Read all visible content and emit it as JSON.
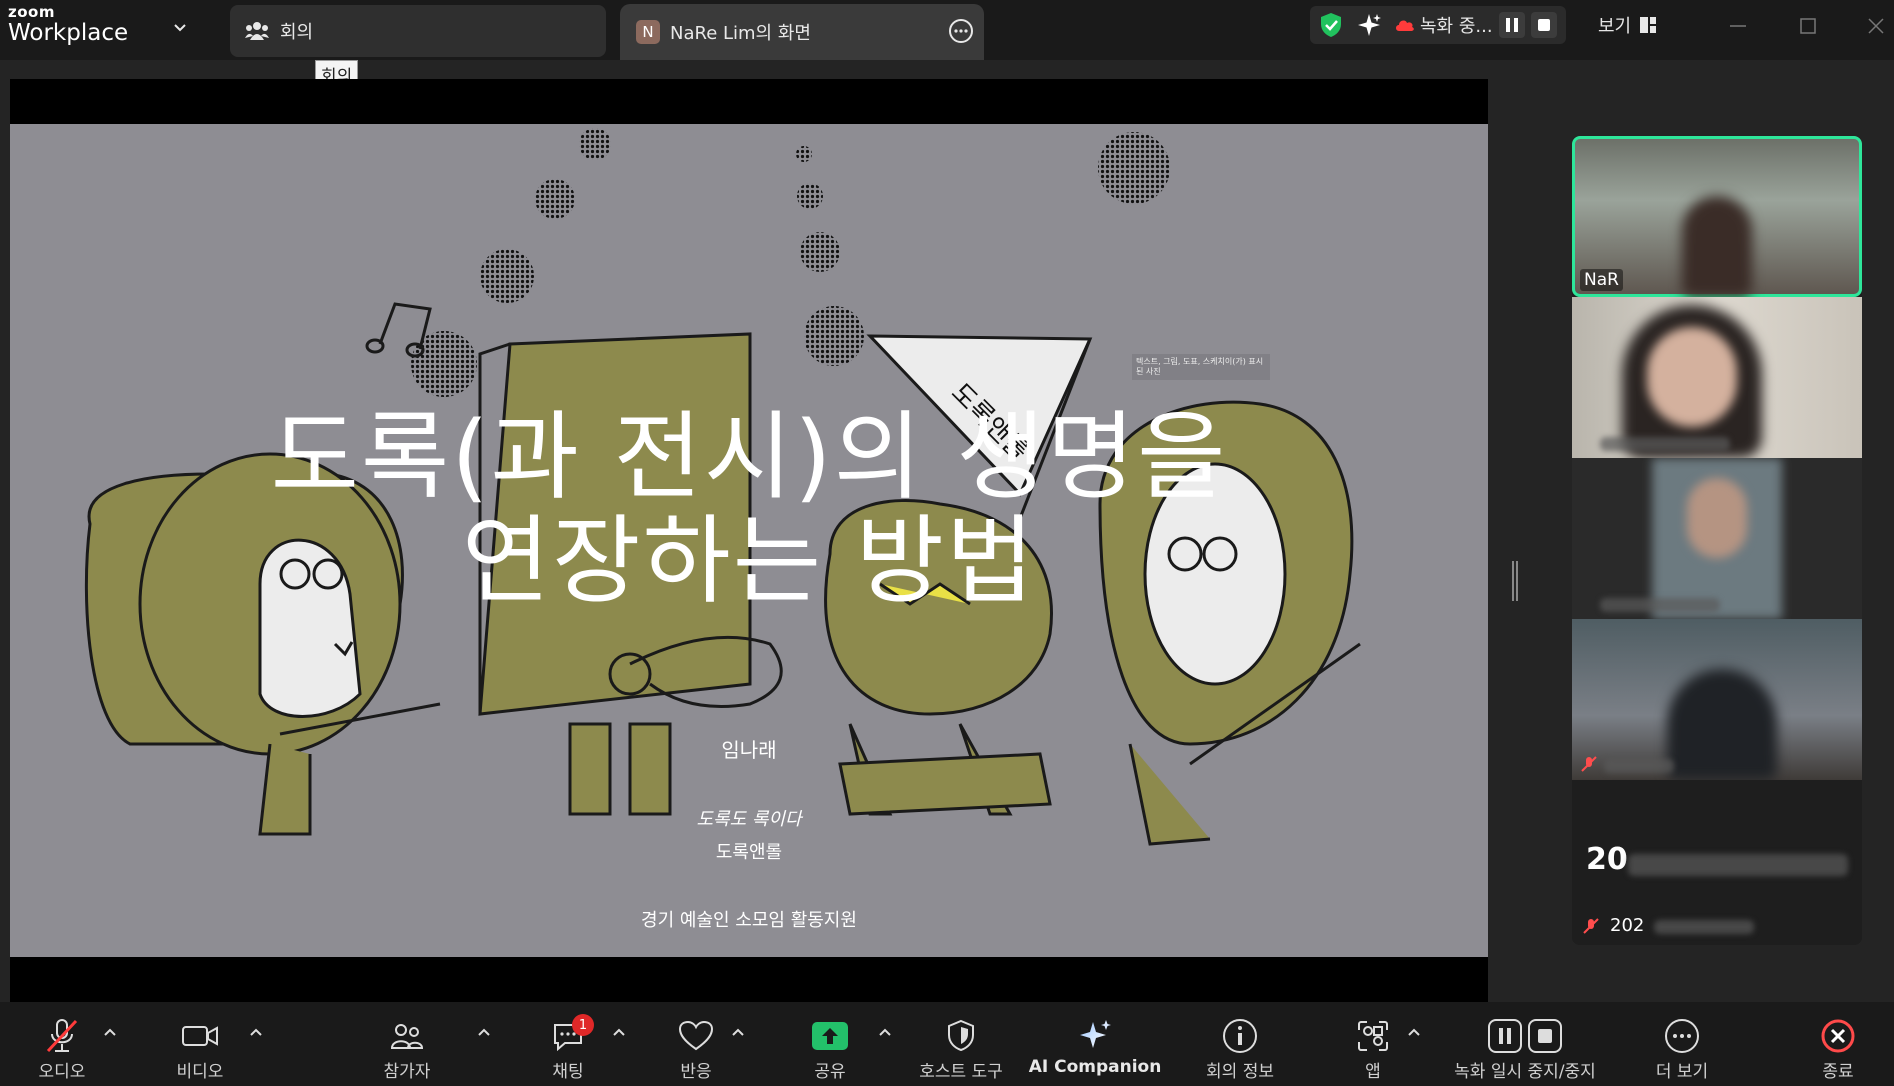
{
  "app": {
    "logo_top": "zoom",
    "logo_bottom": "Workplace"
  },
  "tabs": {
    "meeting_label": "회의",
    "share_avatar_letter": "N",
    "share_label": "NaRe Lim의 화면"
  },
  "tooltip": "회의",
  "status": {
    "recording_label": "녹화 중...",
    "view_label": "보기"
  },
  "slide": {
    "title_line1": "도록(과 전시)의 생명을",
    "title_line2": "연장하는 방법",
    "author": "임나래",
    "subtitle": "도록도 록이다",
    "group": "도록앤롤",
    "sponsor": "경기 예술인 소모임 활동지원",
    "caption": "텍스트, 그림, 도표, 스케치이(가) 표시된 사진",
    "flag_text": "도록앤롤",
    "colors": {
      "background": "#8e8d93",
      "accent": "#8d8a4d"
    }
  },
  "gallery": {
    "tile1_name": "NaR",
    "bottom_big": "20",
    "bottom_small": "202",
    "active_color": "#2ee69a"
  },
  "toolbar": {
    "audio": "오디오",
    "video": "비디오",
    "participants": "참가자",
    "chat": "채팅",
    "chat_badge": "1",
    "react": "반응",
    "share": "공유",
    "host_tools": "호스트 도구",
    "ai_companion": "AI Companion",
    "meeting_info": "회의 정보",
    "apps": "앱",
    "record_pause_stop": "녹화 일시 중지/중지",
    "more": "더 보기",
    "end": "종료"
  }
}
